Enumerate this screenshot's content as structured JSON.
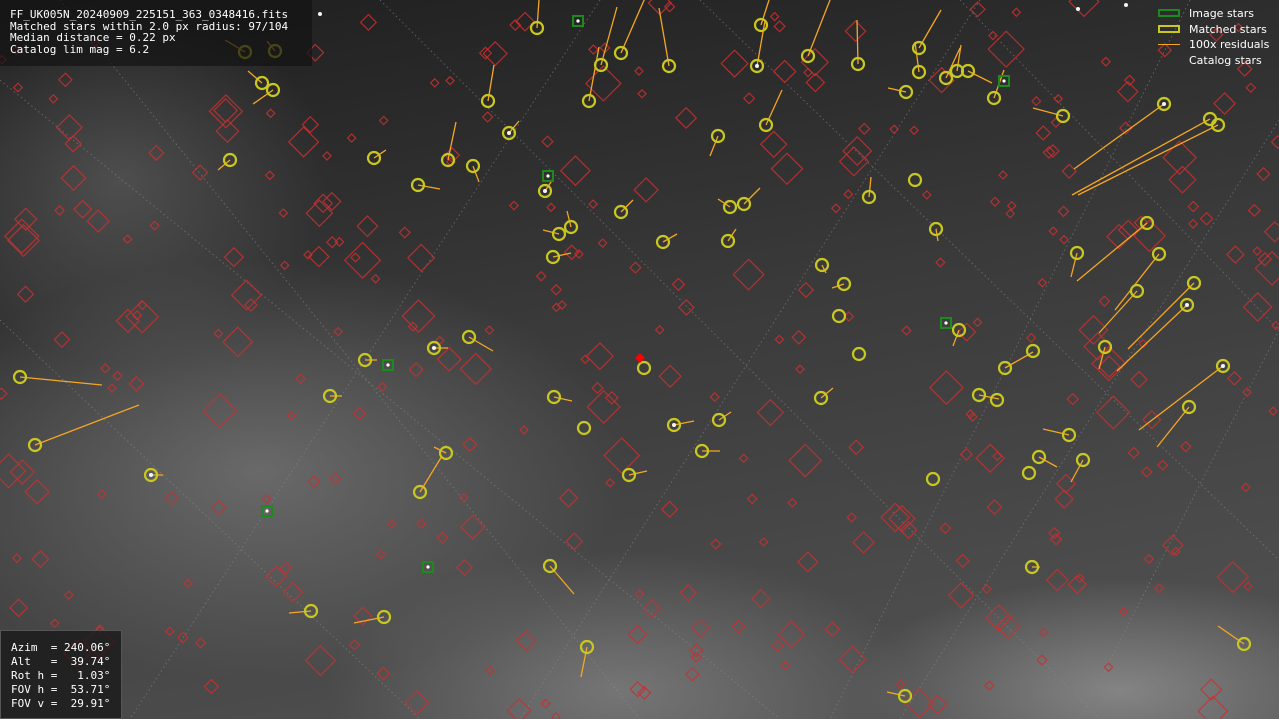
{
  "file_info": {
    "filename": "FF_UK005N_20240909_225151_363_0348416.fits",
    "matched_line": "Matched stars within 2.0 px radius: 97/104",
    "median_line": "Median distance = 0.22 px",
    "catalog_line": "Catalog lim mag = 6.2"
  },
  "pointing": {
    "azim": "Azim  = 240.06°",
    "alt": "Alt   =  39.74°",
    "rot": "Rot h =   1.03°",
    "fov_h": "FOV h =  53.71°",
    "fov_v": "FOV v =  29.91°"
  },
  "legend": {
    "image_stars": "Image stars",
    "matched_stars": "Matched stars",
    "residuals": "100x residuals",
    "catalog_stars": "Catalog stars"
  },
  "colors": {
    "image_star": "#1e8a1e",
    "matched_star": "#c8c820",
    "residual": "#f5a623",
    "catalog_star": "#c83030",
    "center_marker": "#ff0000"
  }
}
